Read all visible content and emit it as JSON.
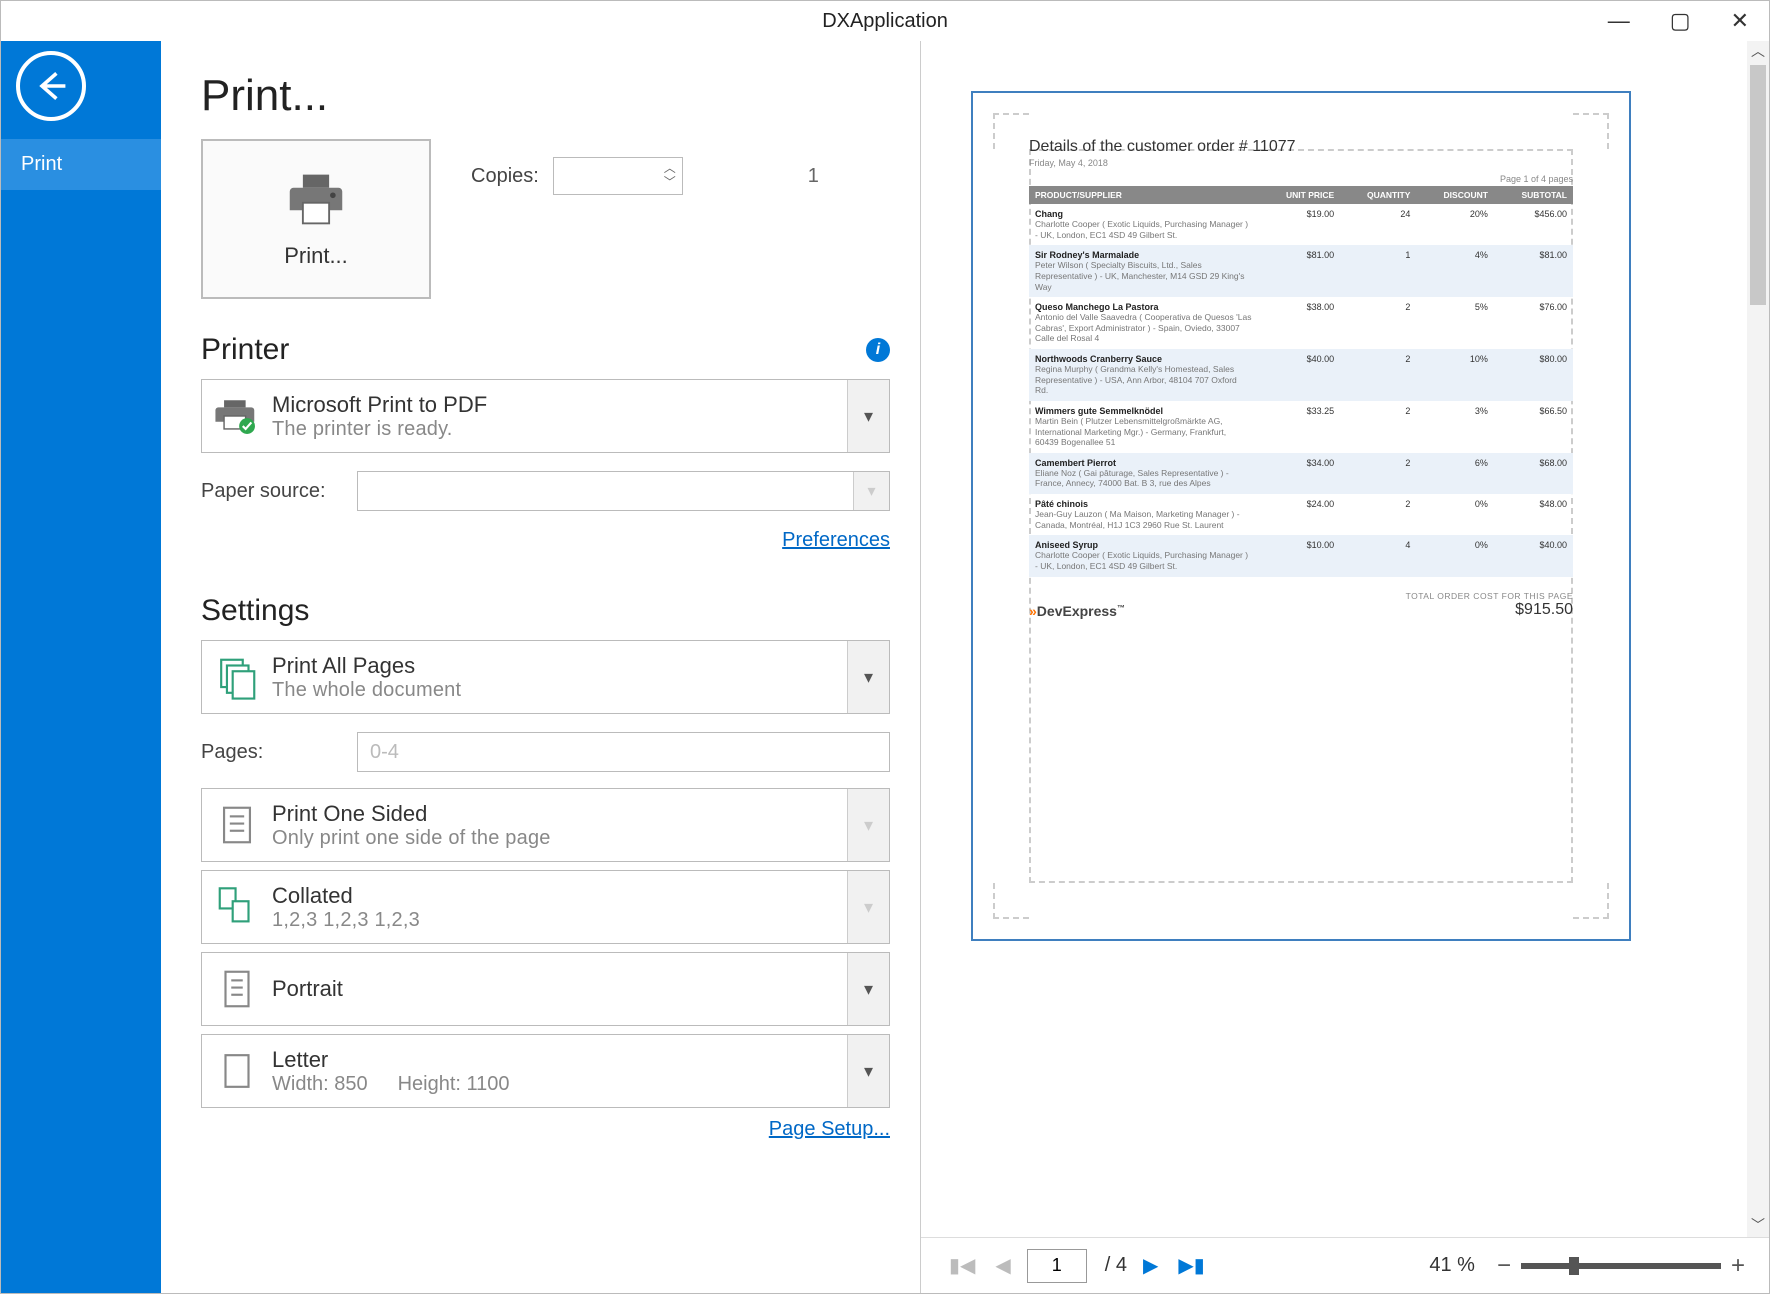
{
  "window": {
    "title": "DXApplication"
  },
  "sidebar": {
    "items": [
      "Print"
    ]
  },
  "page_title": "Print...",
  "print_button_label": "Print...",
  "copies": {
    "label": "Copies:",
    "value": "1"
  },
  "sections": {
    "printer_heading": "Printer",
    "settings_heading": "Settings"
  },
  "printer": {
    "name": "Microsoft Print to PDF",
    "status": "The printer is ready.",
    "paper_source_label": "Paper source:",
    "paper_source_value": "",
    "preferences_link": "Preferences"
  },
  "settings": {
    "print_pages": {
      "line1": "Print All Pages",
      "line2": "The whole document"
    },
    "pages_label": "Pages:",
    "pages_placeholder": "0-4",
    "sides": {
      "line1": "Print One Sided",
      "line2": "Only print one side of the page"
    },
    "collate": {
      "line1": "Collated",
      "line2": "1,2,3   1,2,3   1,2,3"
    },
    "orientation": {
      "line1": "Portrait"
    },
    "paper": {
      "line1": "Letter",
      "width_label": "Width: 850",
      "height_label": "Height: 1100"
    },
    "page_setup_link": "Page Setup..."
  },
  "preview": {
    "report_title": "Details of the customer order # 11077",
    "report_date": "Friday, May 4, 2018",
    "page_of": "Page 1 of 4 pages",
    "columns": [
      "PRODUCT/SUPPLIER",
      "UNIT PRICE",
      "QUANTITY",
      "DISCOUNT",
      "SUBTOTAL"
    ],
    "rows": [
      {
        "name": "Chang",
        "sub": "Charlotte Cooper ( Exotic Liquids, Purchasing Manager )  -  UK, London, EC1 4SD  49 Gilbert St.",
        "unit": "$19.00",
        "qty": "24",
        "disc": "20%",
        "subtotal": "$456.00"
      },
      {
        "name": "Sir Rodney's Marmalade",
        "sub": "Peter Wilson ( Specialty Biscuits, Ltd., Sales Representative )  -  UK, Manchester, M14 GSD  29 King's Way",
        "unit": "$81.00",
        "qty": "1",
        "disc": "4%",
        "subtotal": "$81.00"
      },
      {
        "name": "Queso Manchego La Pastora",
        "sub": "Antonio del Valle Saavedra ( Cooperativa de Quesos 'Las Cabras', Export Administrator )  -  Spain, Oviedo, 33007  Calle del Rosal 4",
        "unit": "$38.00",
        "qty": "2",
        "disc": "5%",
        "subtotal": "$76.00"
      },
      {
        "name": "Northwoods Cranberry Sauce",
        "sub": "Regina Murphy ( Grandma Kelly's Homestead, Sales Representative )  -  USA, Ann Arbor, 48104  707 Oxford Rd.",
        "unit": "$40.00",
        "qty": "2",
        "disc": "10%",
        "subtotal": "$80.00"
      },
      {
        "name": "Wimmers gute Semmelknödel",
        "sub": "Martin Bein ( Plutzer Lebensmittelgroßmärkte AG, International Marketing Mgr.)  -  Germany, Frankfurt, 60439  Bogenallee 51",
        "unit": "$33.25",
        "qty": "2",
        "disc": "3%",
        "subtotal": "$66.50"
      },
      {
        "name": "Camembert Pierrot",
        "sub": "Eliane Noz ( Gai pâturage, Sales Representative )  -  France, Annecy, 74000  Bat. B 3, rue des Alpes",
        "unit": "$34.00",
        "qty": "2",
        "disc": "6%",
        "subtotal": "$68.00"
      },
      {
        "name": "Pâté chinois",
        "sub": "Jean-Guy Lauzon ( Ma Maison, Marketing Manager )  -  Canada, Montréal, H1J 1C3  2960 Rue St. Laurent",
        "unit": "$24.00",
        "qty": "2",
        "disc": "0%",
        "subtotal": "$48.00"
      },
      {
        "name": "Aniseed Syrup",
        "sub": "Charlotte Cooper ( Exotic Liquids, Purchasing Manager )  -  UK, London, EC1 4SD  49 Gilbert St.",
        "unit": "$10.00",
        "qty": "4",
        "disc": "0%",
        "subtotal": "$40.00"
      }
    ],
    "logo_text": "DevExpress",
    "total_label": "TOTAL ORDER COST FOR THIS PAGE",
    "total_value": "$915.50"
  },
  "nav": {
    "current_page": "1",
    "total_pages": "/ 4",
    "zoom_label": "41 %"
  }
}
